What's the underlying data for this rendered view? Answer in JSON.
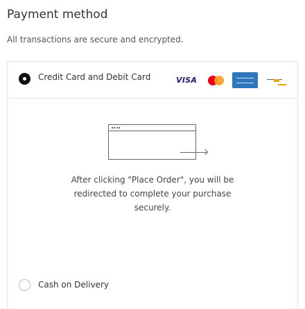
{
  "header": {
    "title": "Payment method",
    "subtitle": "All transactions are secure and encrypted."
  },
  "options": [
    {
      "label": "Credit Card and Debit Card",
      "selected": true
    },
    {
      "label": "Cash on Delivery",
      "selected": false
    }
  ],
  "card_brands": {
    "visa_label": "VISA",
    "icons": [
      "visa-icon",
      "mastercard-icon",
      "amex-icon",
      "generic-card-icon"
    ]
  },
  "redirect": {
    "message": "After clicking \"Place Order\", you will be redirected to complete your purchase securely.",
    "icon": "offsite-redirect-icon"
  }
}
